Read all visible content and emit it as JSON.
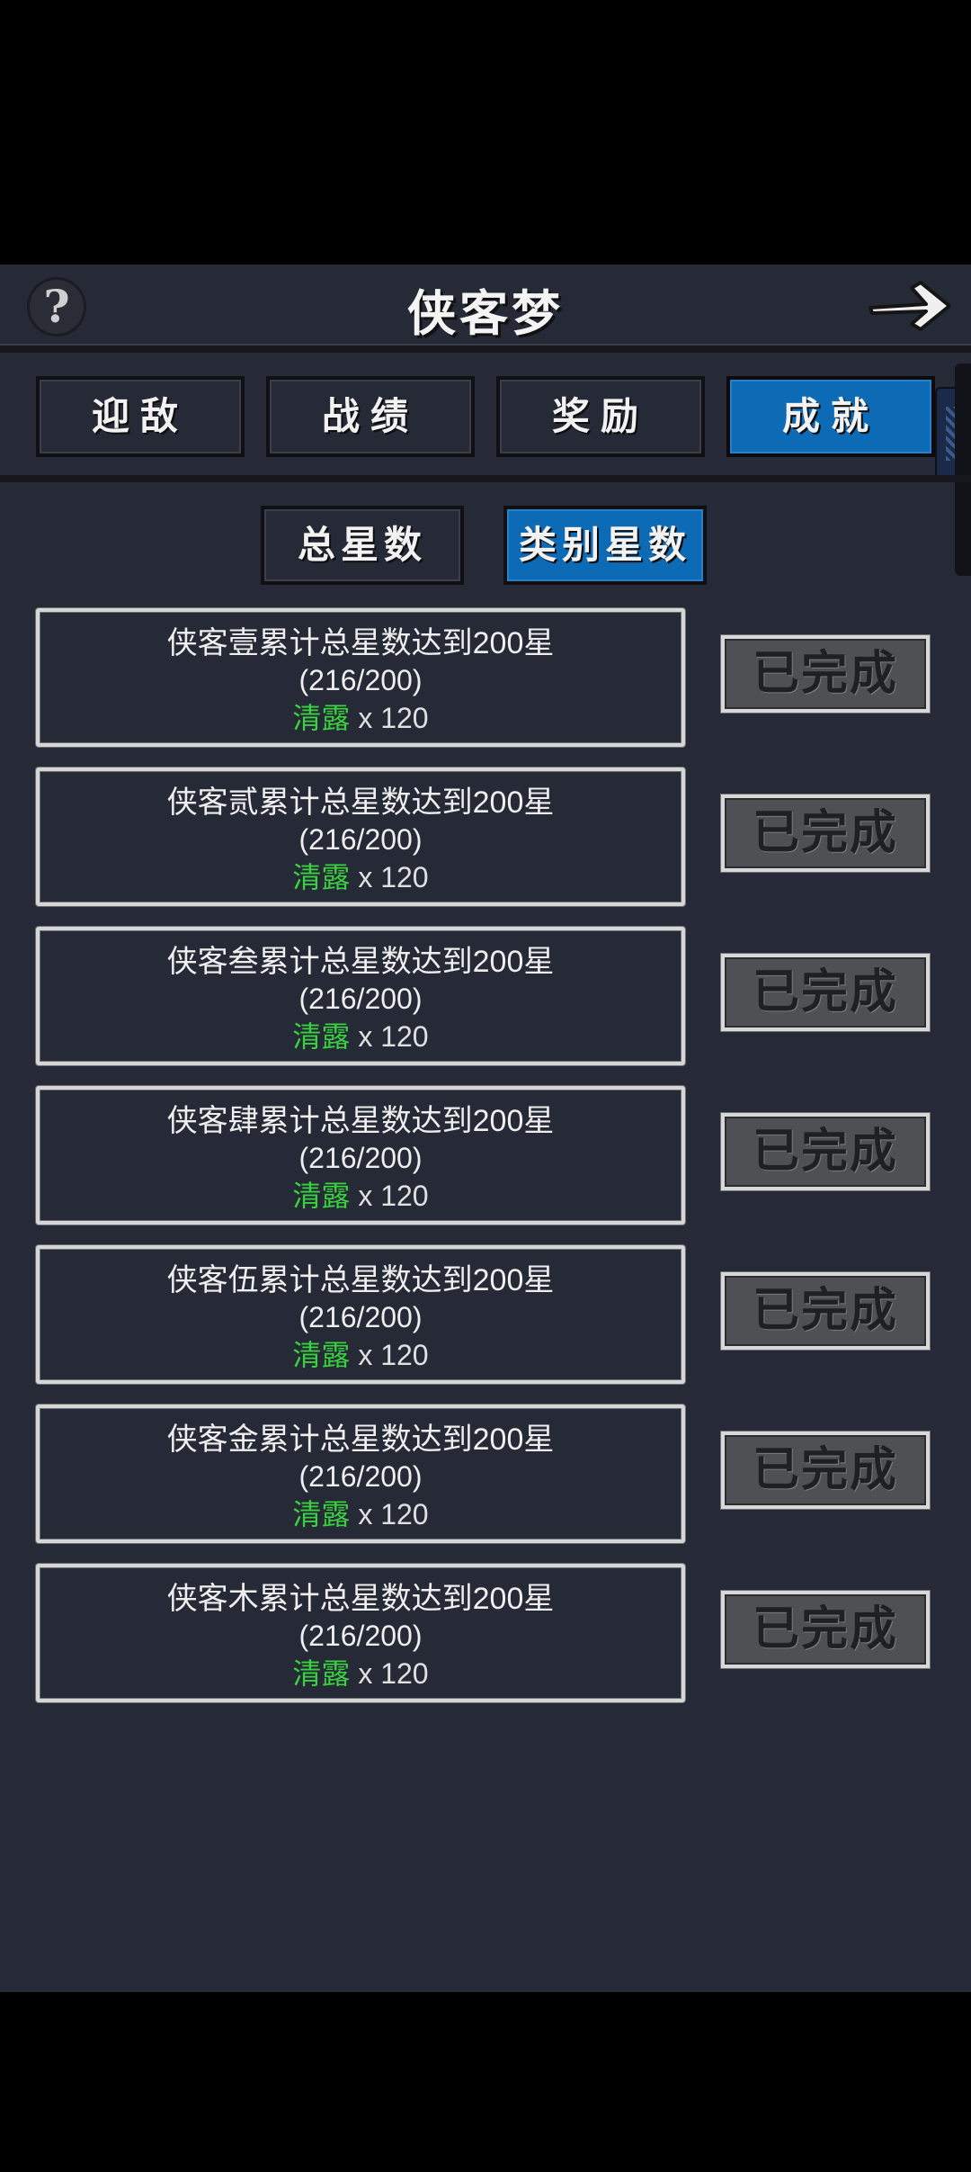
{
  "header": {
    "title": "侠客梦",
    "help_symbol": "?"
  },
  "main_tabs": [
    {
      "label": "迎敌",
      "active": false
    },
    {
      "label": "战绩",
      "active": false
    },
    {
      "label": "奖励",
      "active": false
    },
    {
      "label": "成就",
      "active": true
    }
  ],
  "sub_tabs": [
    {
      "label": "总星数",
      "active": false
    },
    {
      "label": "类别星数",
      "active": true
    }
  ],
  "achievements": [
    {
      "description": "侠客壹累计总星数达到200星",
      "progress": "(216/200)",
      "reward_name": "清露",
      "reward_amount": "x 120",
      "status": "已完成"
    },
    {
      "description": "侠客贰累计总星数达到200星",
      "progress": "(216/200)",
      "reward_name": "清露",
      "reward_amount": "x 120",
      "status": "已完成"
    },
    {
      "description": "侠客叁累计总星数达到200星",
      "progress": "(216/200)",
      "reward_name": "清露",
      "reward_amount": "x 120",
      "status": "已完成"
    },
    {
      "description": "侠客肆累计总星数达到200星",
      "progress": "(216/200)",
      "reward_name": "清露",
      "reward_amount": "x 120",
      "status": "已完成"
    },
    {
      "description": "侠客伍累计总星数达到200星",
      "progress": "(216/200)",
      "reward_name": "清露",
      "reward_amount": "x 120",
      "status": "已完成"
    },
    {
      "description": "侠客金累计总星数达到200星",
      "progress": "(216/200)",
      "reward_name": "清露",
      "reward_amount": "x 120",
      "status": "已完成"
    },
    {
      "description": "侠客木累计总星数达到200星",
      "progress": "(216/200)",
      "reward_name": "清露",
      "reward_amount": "x 120",
      "status": "已完成"
    }
  ],
  "colors": {
    "background": "#262a36",
    "active_tab": "#0d6ab5",
    "reward_name": "#38d23e",
    "done_button": "#4f5054"
  }
}
